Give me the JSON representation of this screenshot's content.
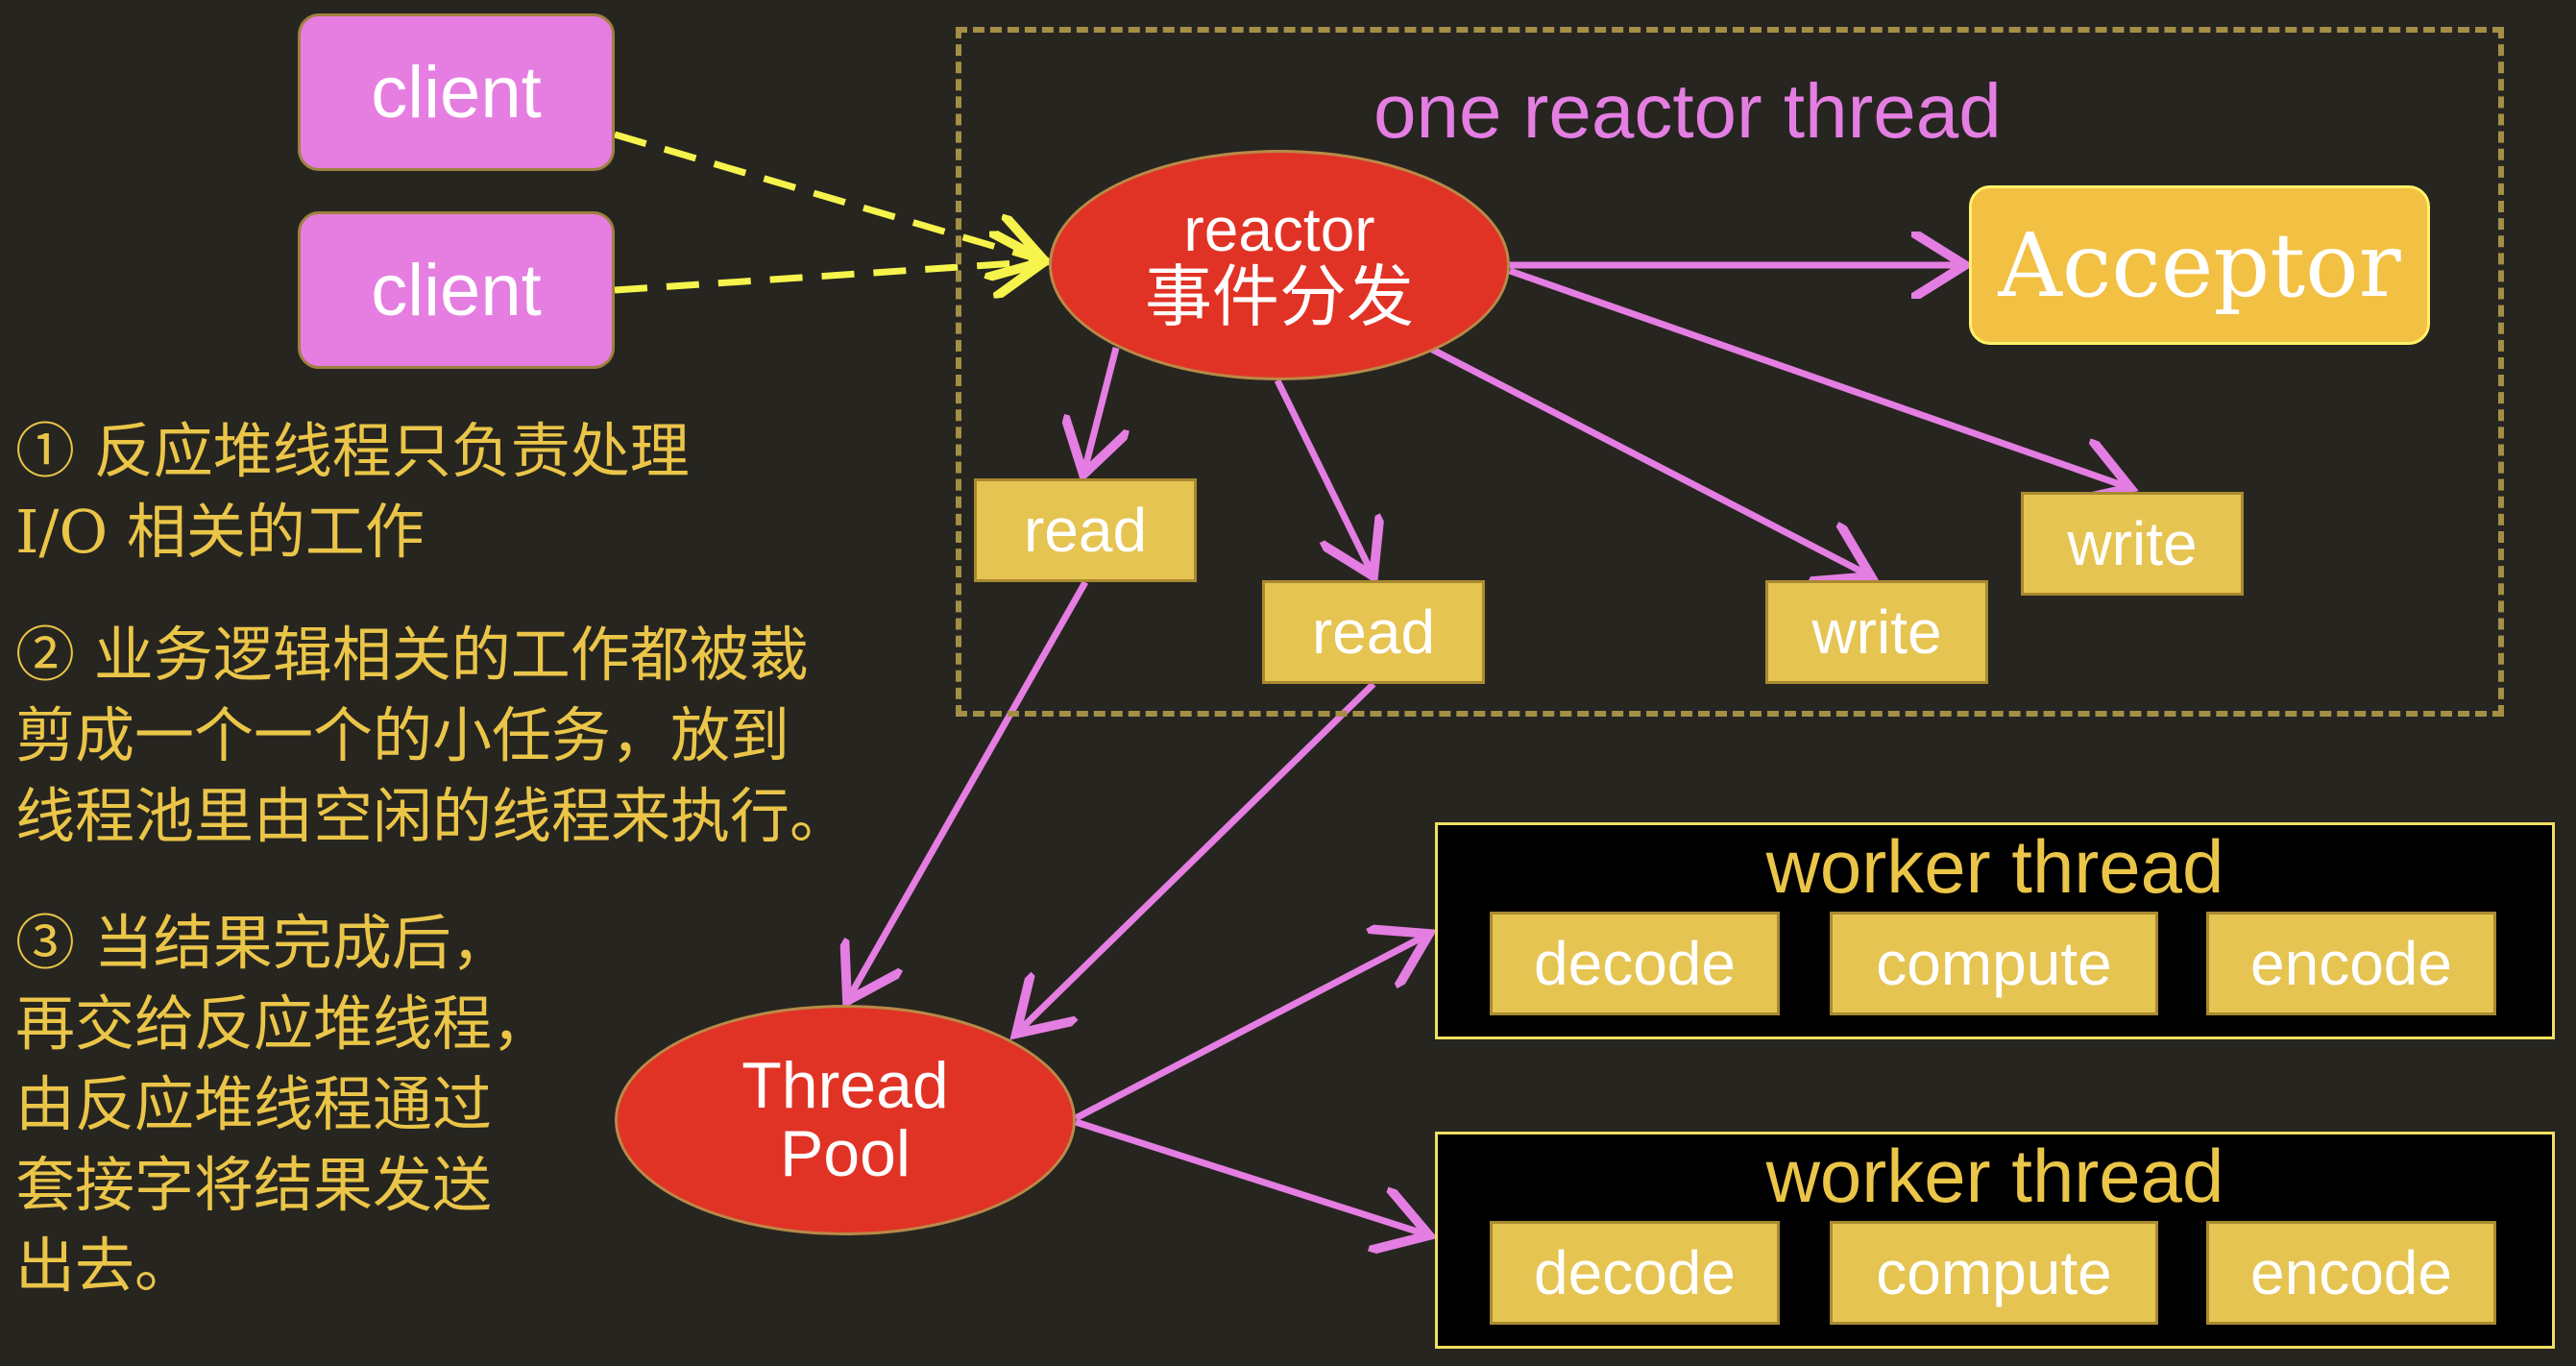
{
  "colors": {
    "background": "#272520",
    "client": "#e57ee0",
    "ellipse": "#e13325",
    "op_box": "#e6c452",
    "acceptor": "#f2c042",
    "arrow": "#e47ee2",
    "client_arrow": "#f6f44c",
    "frame_border": "#a38f45",
    "note_text": "#eac548"
  },
  "clients": [
    {
      "label": "client"
    },
    {
      "label": "client"
    }
  ],
  "reactor_frame": {
    "title": "one reactor thread"
  },
  "reactor": {
    "line1": "reactor",
    "line2": "事件分发"
  },
  "acceptor": {
    "label": "Acceptor"
  },
  "ops": {
    "read1": "read",
    "read2": "read",
    "write1": "write",
    "write2": "write"
  },
  "thread_pool": {
    "line1": "Thread",
    "line2": "Pool"
  },
  "workers": [
    {
      "title": "worker thread",
      "tasks": [
        "decode",
        "compute",
        "encode"
      ]
    },
    {
      "title": "worker thread",
      "tasks": [
        "decode",
        "compute",
        "encode"
      ]
    }
  ],
  "notes": [
    "① 反应堆线程只负责处理\nI/O 相关的工作",
    "② 业务逻辑相关的工作都被裁\n剪成一个一个的小任务，放到\n线程池里由空闲的线程来执行。",
    "③ 当结果完成后，\n再交给反应堆线程，\n由反应堆线程通过\n套接字将结果发送\n出去。"
  ]
}
